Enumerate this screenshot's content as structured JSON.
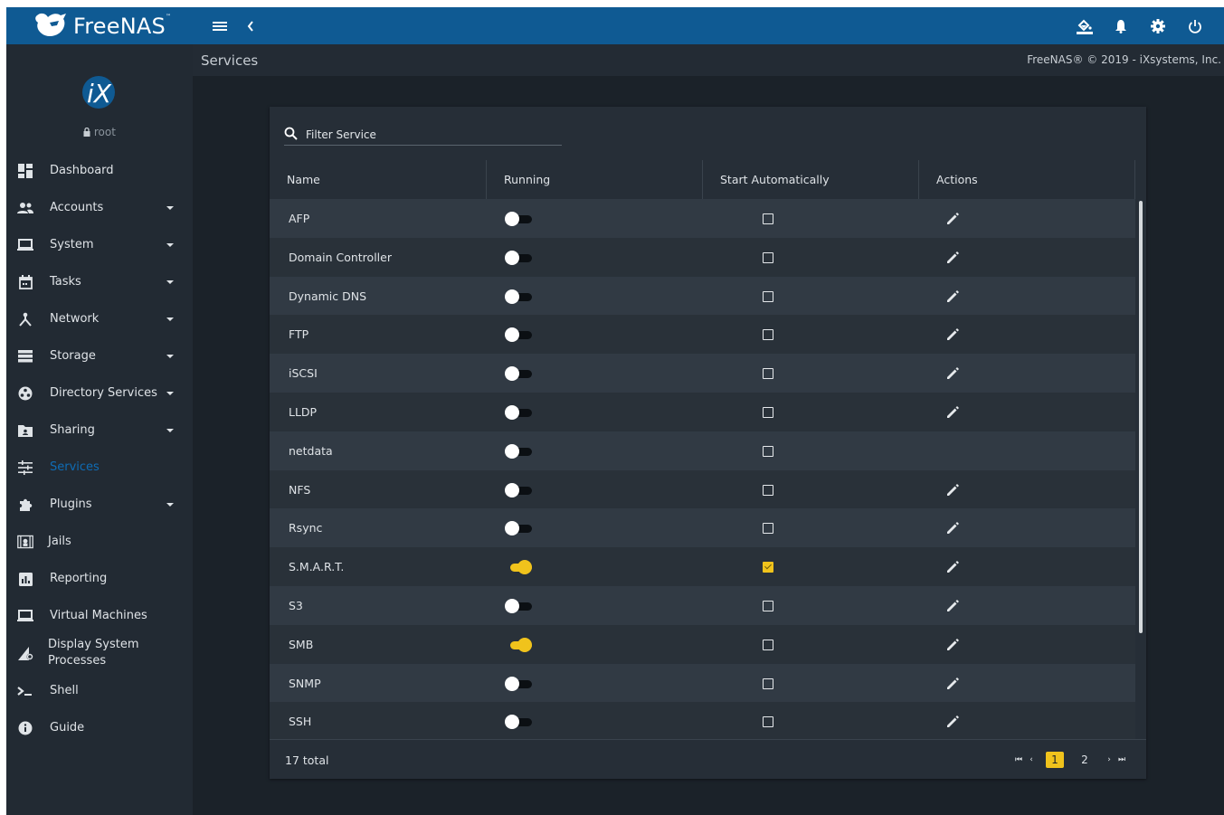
{
  "topbar": {
    "brand": "FreeNAS",
    "brand_mark": "™",
    "icons": [
      "menu-icon",
      "chevron-left-icon",
      "theme-icon",
      "bell-icon",
      "gear-icon",
      "power-icon"
    ]
  },
  "sidebar": {
    "logo_text": "iX",
    "user": "root",
    "items": [
      {
        "label": "Dashboard",
        "icon": "dashboard-icon",
        "caret": false,
        "active": false
      },
      {
        "label": "Accounts",
        "icon": "accounts-icon",
        "caret": true,
        "active": false
      },
      {
        "label": "System",
        "icon": "system-icon",
        "caret": true,
        "active": false
      },
      {
        "label": "Tasks",
        "icon": "tasks-icon",
        "caret": true,
        "active": false
      },
      {
        "label": "Network",
        "icon": "network-icon",
        "caret": true,
        "active": false
      },
      {
        "label": "Storage",
        "icon": "storage-icon",
        "caret": true,
        "active": false
      },
      {
        "label": "Directory Services",
        "icon": "directory-icon",
        "caret": true,
        "active": false
      },
      {
        "label": "Sharing",
        "icon": "sharing-icon",
        "caret": true,
        "active": false
      },
      {
        "label": "Services",
        "icon": "services-icon",
        "caret": false,
        "active": true
      },
      {
        "label": "Plugins",
        "icon": "plugins-icon",
        "caret": true,
        "active": false
      },
      {
        "label": "Jails",
        "icon": "jails-icon",
        "caret": false,
        "active": false
      },
      {
        "label": "Reporting",
        "icon": "reporting-icon",
        "caret": false,
        "active": false
      },
      {
        "label": "Virtual Machines",
        "icon": "vm-icon",
        "caret": false,
        "active": false
      },
      {
        "label": "Display System Processes",
        "icon": "processes-icon",
        "caret": false,
        "active": false
      },
      {
        "label": "Shell",
        "icon": "shell-icon",
        "caret": false,
        "active": false
      },
      {
        "label": "Guide",
        "icon": "info-icon",
        "caret": false,
        "active": false
      }
    ]
  },
  "header": {
    "breadcrumb": "Services",
    "copyright": "FreeNAS® © 2019 - iXsystems, Inc."
  },
  "table": {
    "filter_placeholder": "Filter Service",
    "columns": [
      "Name",
      "Running",
      "Start Automatically",
      "Actions"
    ],
    "rows": [
      {
        "name": "AFP",
        "running": false,
        "auto": false,
        "editable": true
      },
      {
        "name": "Domain Controller",
        "running": false,
        "auto": false,
        "editable": true
      },
      {
        "name": "Dynamic DNS",
        "running": false,
        "auto": false,
        "editable": true
      },
      {
        "name": "FTP",
        "running": false,
        "auto": false,
        "editable": true
      },
      {
        "name": "iSCSI",
        "running": false,
        "auto": false,
        "editable": true
      },
      {
        "name": "LLDP",
        "running": false,
        "auto": false,
        "editable": true
      },
      {
        "name": "netdata",
        "running": false,
        "auto": false,
        "editable": false
      },
      {
        "name": "NFS",
        "running": false,
        "auto": false,
        "editable": true
      },
      {
        "name": "Rsync",
        "running": false,
        "auto": false,
        "editable": true
      },
      {
        "name": "S.M.A.R.T.",
        "running": true,
        "auto": true,
        "editable": true
      },
      {
        "name": "S3",
        "running": false,
        "auto": false,
        "editable": true
      },
      {
        "name": "SMB",
        "running": true,
        "auto": false,
        "editable": true
      },
      {
        "name": "SNMP",
        "running": false,
        "auto": false,
        "editable": true
      },
      {
        "name": "SSH",
        "running": false,
        "auto": false,
        "editable": true
      }
    ],
    "total": "17 total",
    "pager": {
      "first": "⏮",
      "prev": "‹",
      "pages": [
        "1",
        "2"
      ],
      "current": "1",
      "next": "›",
      "last": "⏭"
    }
  },
  "colors": {
    "topbar": "#0f5a93",
    "accent": "#f0c31c",
    "active_nav": "#0f6cb5"
  }
}
